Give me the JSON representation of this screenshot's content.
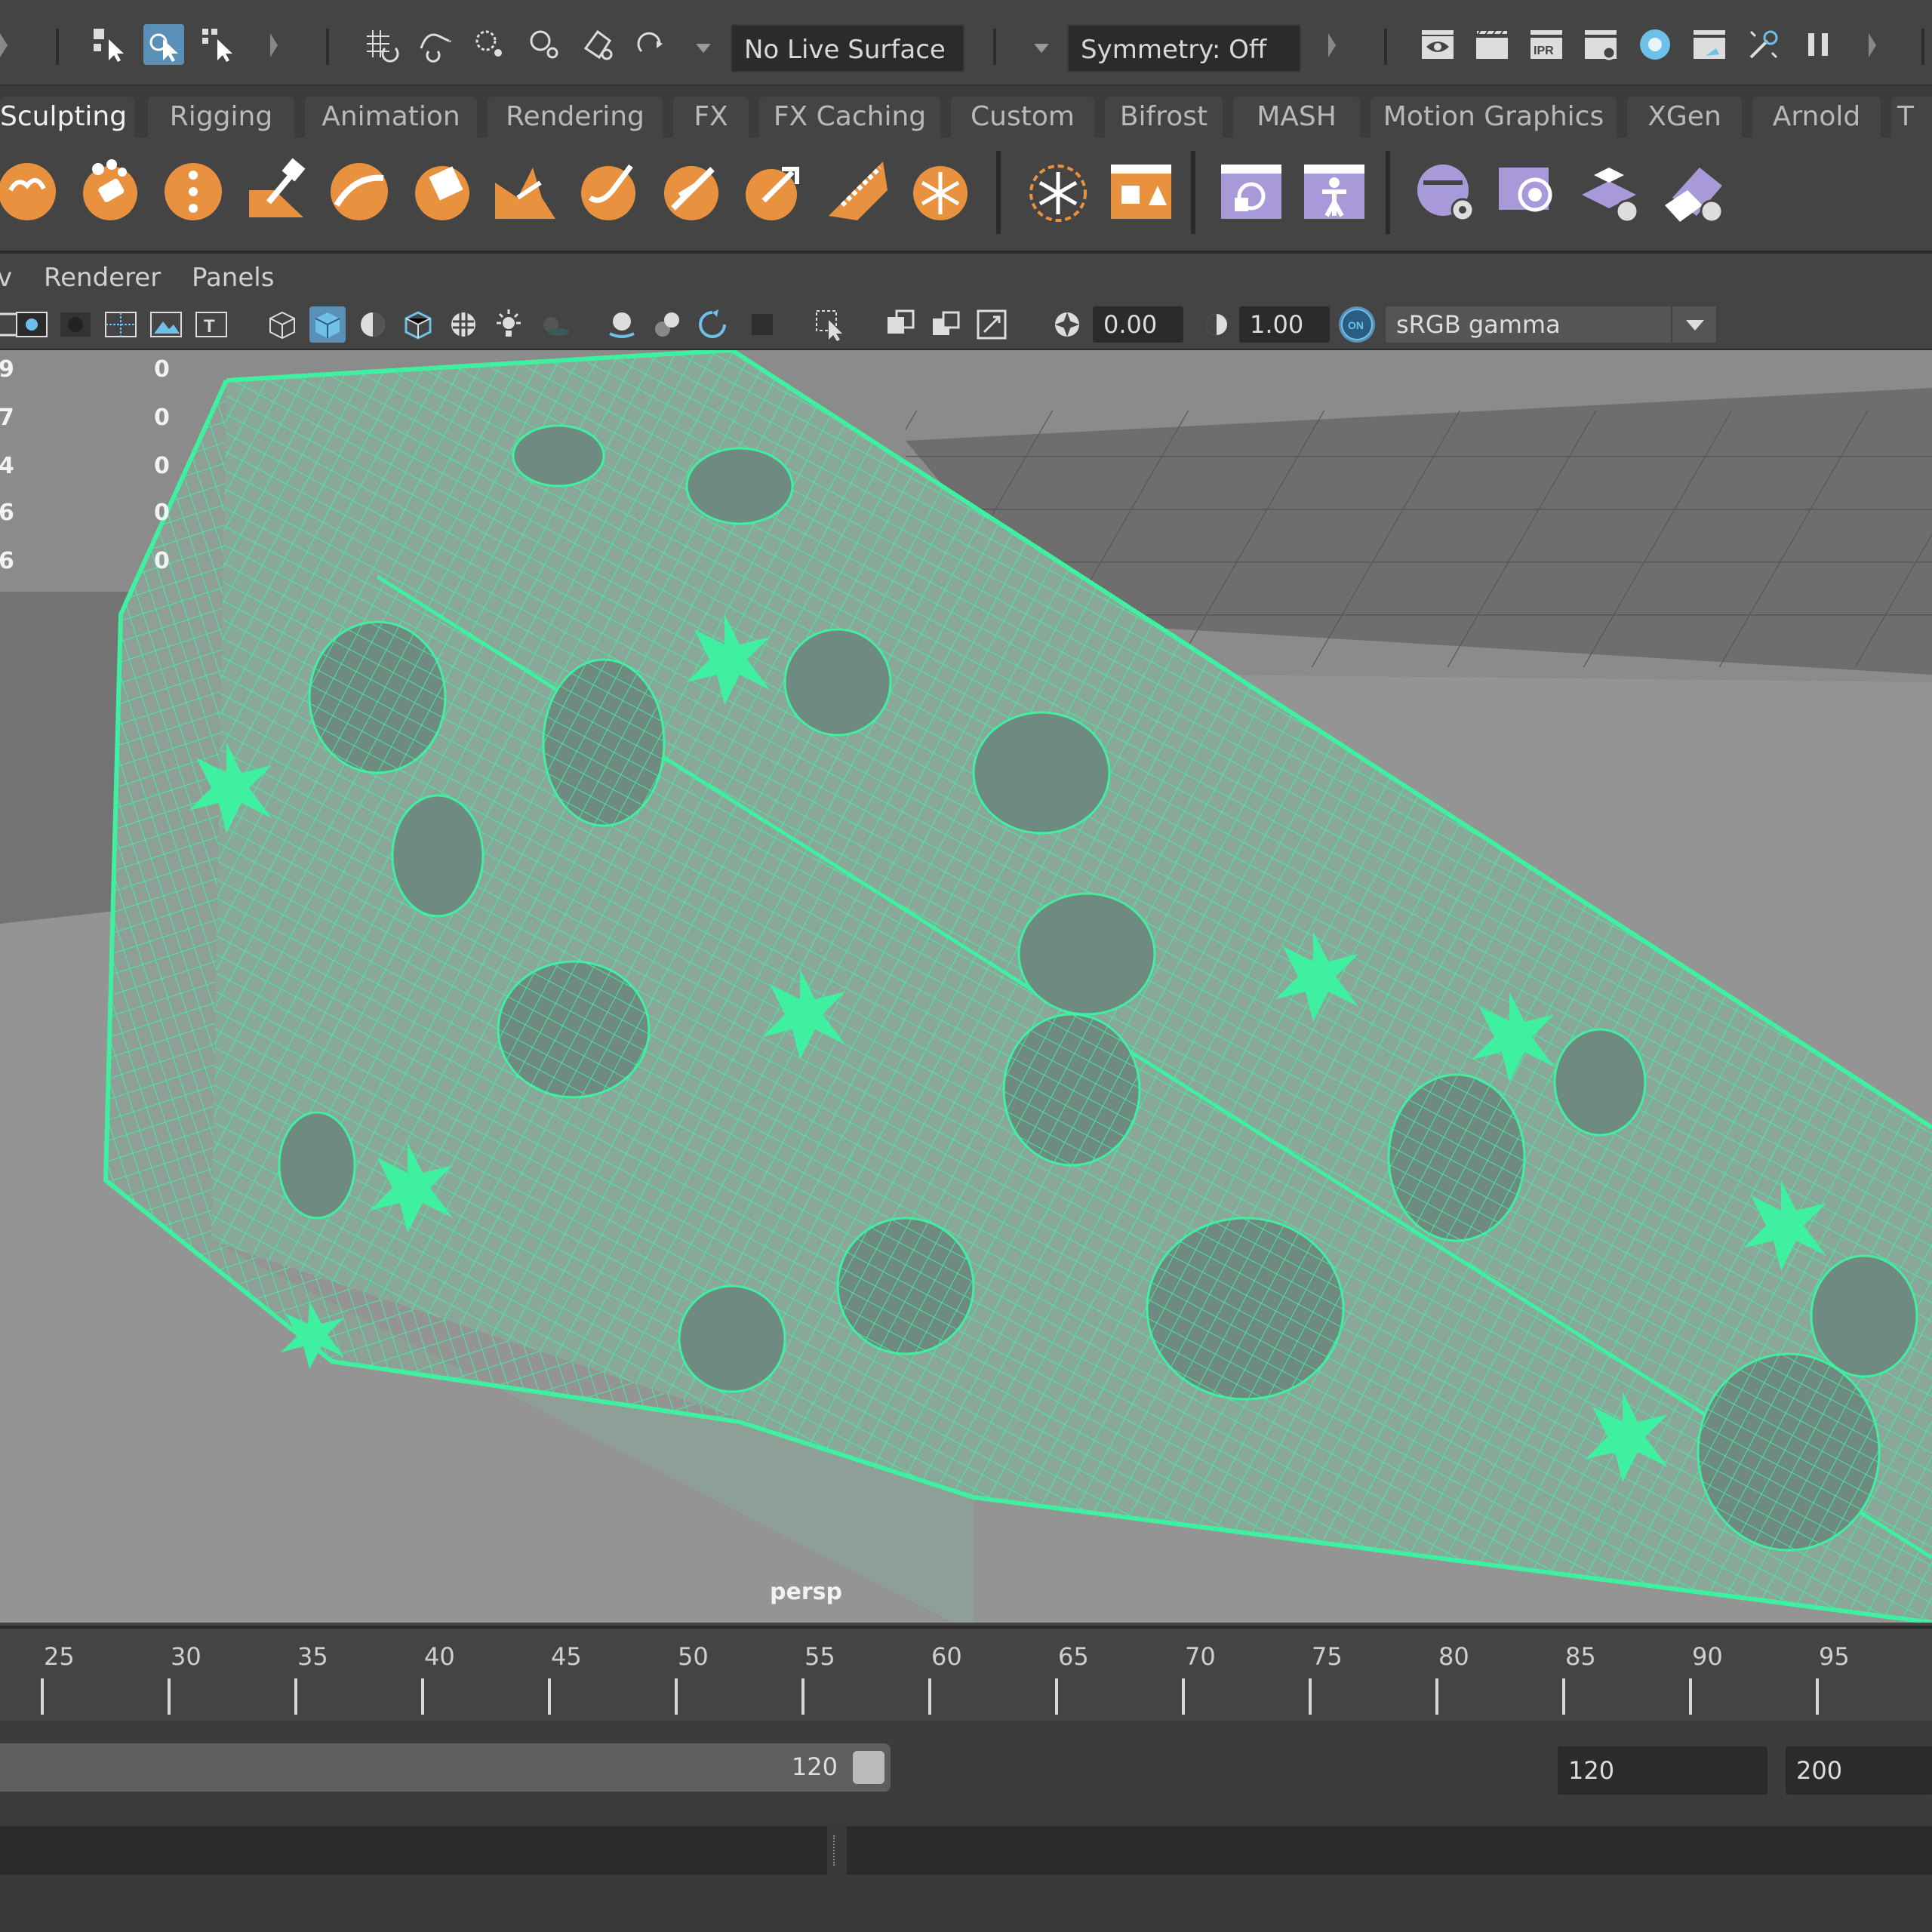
{
  "status_line": {
    "live_surface": "No Live Surface",
    "symmetry": "Symmetry: Off"
  },
  "shelf_tabs": [
    "Sculpting",
    "Rigging",
    "Animation",
    "Rendering",
    "FX",
    "FX Caching",
    "Custom",
    "Bifrost",
    "MASH",
    "Motion Graphics",
    "XGen",
    "Arnold",
    "T"
  ],
  "active_tab": "Sculpting",
  "panel_menu": {
    "truncated": "v",
    "renderer": "Renderer",
    "panels": "Panels"
  },
  "panel_toolbar": {
    "exposure": "0.00",
    "gamma": "1.00",
    "color_mode": "sRGB gamma",
    "on_badge": "ON"
  },
  "hud_rows": [
    {
      "left": "9",
      "right": "0"
    },
    {
      "left": "7",
      "right": "0"
    },
    {
      "left": "4",
      "right": "0"
    },
    {
      "left": "6",
      "right": "0"
    },
    {
      "left": "6",
      "right": "0"
    }
  ],
  "camera_label": "persp",
  "time_slider": {
    "ticks": [
      "25",
      "30",
      "35",
      "40",
      "45",
      "50",
      "55",
      "60",
      "65",
      "70",
      "75",
      "80",
      "85",
      "90",
      "95"
    ]
  },
  "range_slider": {
    "current_end": "120",
    "end_time": "120",
    "max_time": "200"
  },
  "colors": {
    "wireframe": "#3ff0a0",
    "accent": "#5a8fb8",
    "shelf_icon": "#e8913f",
    "shelf_icon_purple": "#a89ad8"
  }
}
